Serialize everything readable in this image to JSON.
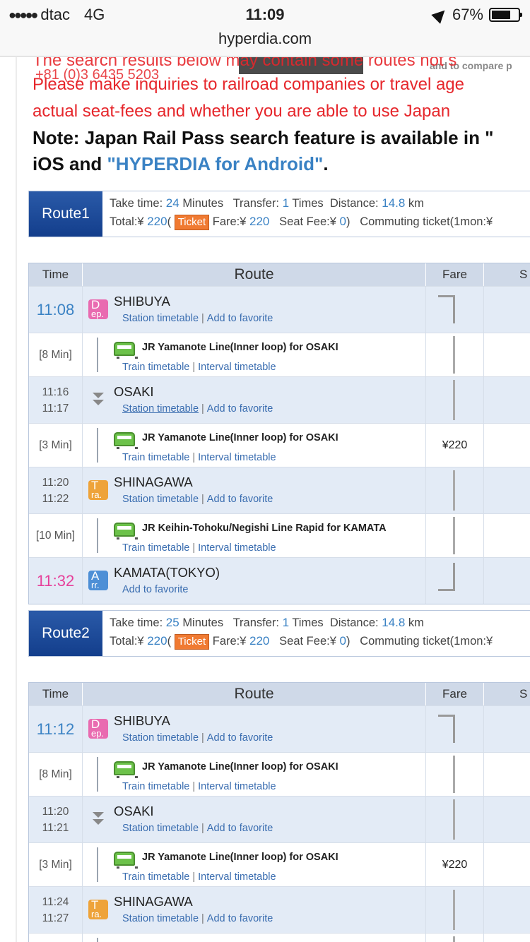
{
  "status": {
    "carrier": "dtac",
    "network": "4G",
    "time": "11:09",
    "battery": "67%"
  },
  "browser": {
    "url": "hyperdia.com"
  },
  "notice": {
    "overlap_top": "The search results below may contain some routes not s",
    "phone": "+81 (0)3   6435 5203",
    "promo": "and to compare p",
    "line2": "Please make inquiries to railroad companies or travel age",
    "line3": "actual seat-fees and whether you are able to use Japan",
    "note_prefix": "Note: Japan Rail Pass search feature is available in \"",
    "ios": "iOS and",
    "android": "\"HYPERDIA for Android\"",
    "android_end": "."
  },
  "labels": {
    "take_time": "Take time:",
    "minutes": "Minutes",
    "transfer": "Transfer:",
    "times": "Times",
    "distance": "Distance:",
    "km": "km",
    "total": "Total:¥",
    "ticket": "Ticket",
    "fare": "Fare:¥",
    "seat_fee": "Seat Fee:¥",
    "commuting": "Commuting ticket(1mon:¥",
    "th_time": "Time",
    "th_route": "Route",
    "th_fare": "Fare",
    "th_seat": "S",
    "station_timetable": "Station timetable",
    "add_favorite": "Add to favorite",
    "train_timetable": "Train timetable",
    "interval_timetable": "Interval timetable",
    "sep": "|"
  },
  "routes": [
    {
      "label": "Route1",
      "take_time": "24",
      "transfer": "1",
      "distance": "14.8",
      "total": "220",
      "fare": "220",
      "seat_fee": "0",
      "rows": [
        {
          "kind": "station",
          "time": "11:08",
          "name": "SHIBUYA"
        },
        {
          "kind": "line",
          "duration": "[8 Min]",
          "name": "JR Yamanote Line(Inner loop)  for OSAKI"
        },
        {
          "kind": "station",
          "time1": "11:16",
          "time2": "11:17",
          "name": "OSAKI"
        },
        {
          "kind": "line",
          "duration": "[3 Min]",
          "name": "JR Yamanote Line(Inner loop)  for OSAKI",
          "fare": "¥220"
        },
        {
          "kind": "station",
          "time1": "11:20",
          "time2": "11:22",
          "name": "SHINAGAWA"
        },
        {
          "kind": "line",
          "duration": "[10 Min]",
          "name": "JR Keihin-Tohoku/Negishi Line Rapid  for KAMATA"
        },
        {
          "kind": "station",
          "time": "11:32",
          "name": "KAMATA(TOKYO)"
        }
      ]
    },
    {
      "label": "Route2",
      "take_time": "25",
      "transfer": "1",
      "distance": "14.8",
      "total": "220",
      "fare": "220",
      "seat_fee": "0",
      "rows": [
        {
          "kind": "station",
          "time": "11:12",
          "name": "SHIBUYA"
        },
        {
          "kind": "line",
          "duration": "[8 Min]",
          "name": "JR Yamanote Line(Inner loop)  for OSAKI"
        },
        {
          "kind": "station",
          "time1": "11:20",
          "time2": "11:21",
          "name": "OSAKI"
        },
        {
          "kind": "line",
          "duration": "[3 Min]",
          "name": "JR Yamanote Line(Inner loop)  for OSAKI",
          "fare": "¥220"
        },
        {
          "kind": "station",
          "time1": "11:24",
          "time2": "11:27",
          "name": "SHINAGAWA"
        }
      ]
    }
  ],
  "badges": {
    "dep_big": "D",
    "dep_small": "ep.",
    "tra_big": "T",
    "tra_small": "ra.",
    "arr_big": "A",
    "arr_small": "rr."
  }
}
